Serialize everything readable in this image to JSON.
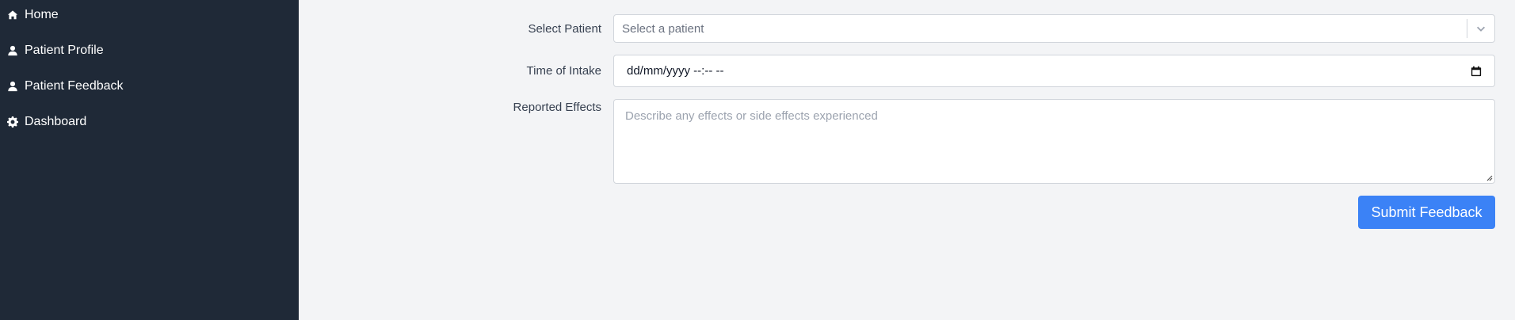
{
  "sidebar": {
    "items": [
      {
        "label": "Home",
        "icon": "home-icon"
      },
      {
        "label": "Patient Profile",
        "icon": "user-icon"
      },
      {
        "label": "Patient Feedback",
        "icon": "user-icon"
      },
      {
        "label": "Dashboard",
        "icon": "gear-icon"
      }
    ],
    "background": "#1f2937"
  },
  "form": {
    "patient": {
      "label": "Select Patient",
      "placeholder": "Select a patient"
    },
    "intake": {
      "label": "Time of Intake",
      "value": "dd/mm/yyyy --:-- --"
    },
    "effects": {
      "label": "Reported Effects",
      "placeholder": "Describe any effects or side effects experienced"
    },
    "submit_label": "Submit Feedback"
  },
  "colors": {
    "accent": "#3b82f6",
    "page_background": "#f3f4f6"
  }
}
